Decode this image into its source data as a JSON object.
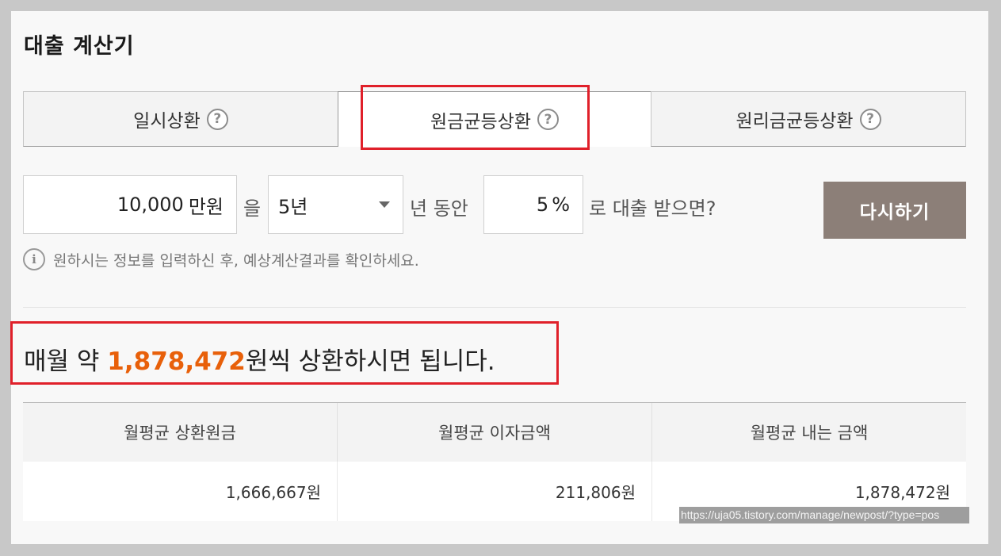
{
  "title": "대출 계산기",
  "tabs": [
    {
      "label": "일시상환",
      "help": "?"
    },
    {
      "label": "원금균등상환",
      "help": "?"
    },
    {
      "label": "원리금균등상환",
      "help": "?"
    }
  ],
  "form": {
    "amount_value": "10,000",
    "amount_unit": "만원",
    "joiner_1": "을",
    "period_selected": "5년",
    "joiner_2": "년 동안",
    "rate_value": "5",
    "rate_unit": "%",
    "joiner_3": "로 대출 받으면?",
    "reset_label": "다시하기"
  },
  "info": {
    "icon": "i",
    "text": "원하시는 정보를 입력하신 후, 예상계산결과를 확인하세요."
  },
  "result": {
    "prefix": "매월 약 ",
    "amount": "1,878,472",
    "suffix": "원씩 상환하시면 됩니다."
  },
  "table": {
    "headers": [
      "월평균 상환원금",
      "월평균 이자금액",
      "월평균 내는 금액"
    ],
    "values": [
      "1,666,667원",
      "211,806원",
      "1,878,472원"
    ]
  },
  "status_url": "https://uja05.tistory.com/manage/newpost/?type=pos",
  "colors": {
    "accent_orange": "#e8600a",
    "highlight_red": "#e0202a",
    "button_bg": "#8c7f78"
  }
}
